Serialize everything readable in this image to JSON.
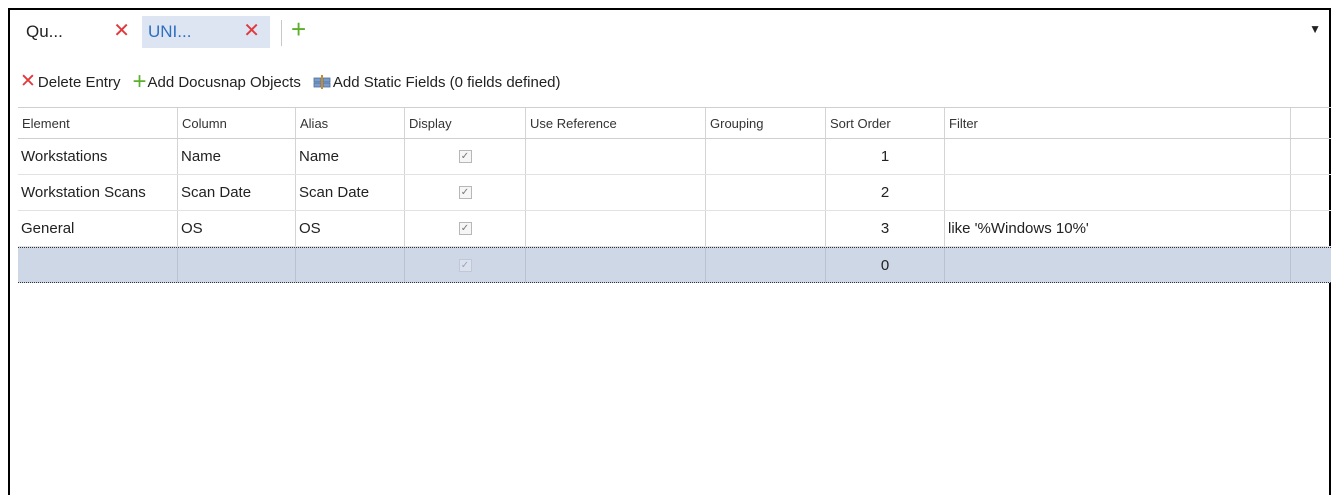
{
  "tabs": [
    {
      "label": "Qu...",
      "active": true
    },
    {
      "label": "UNI...",
      "active": false
    }
  ],
  "icons": {
    "close": "close-icon",
    "add_tab": "plus-icon",
    "dropdown": "chevron-down-icon",
    "fields": "fields-icon"
  },
  "toolbar": {
    "delete_label": "Delete Entry",
    "add_objects_label": "Add Docusnap Objects",
    "add_static_label": "Add Static Fields (0 fields defined)"
  },
  "grid": {
    "columns": [
      "Element",
      "Column",
      "Alias",
      "Display",
      "Use Reference",
      "Grouping",
      "Sort Order",
      "Filter"
    ],
    "rows": [
      {
        "element": "Workstations",
        "column": "Name",
        "alias": "Name",
        "display": true,
        "use_reference": "",
        "grouping": "",
        "sort_order": "1",
        "filter": ""
      },
      {
        "element": "Workstation Scans",
        "column": "Scan Date",
        "alias": "Scan Date",
        "display": true,
        "use_reference": "",
        "grouping": "",
        "sort_order": "2",
        "filter": ""
      },
      {
        "element": "General",
        "column": "OS",
        "alias": "OS",
        "display": true,
        "use_reference": "",
        "grouping": "",
        "sort_order": "3",
        "filter": "like '%Windows 10%'"
      },
      {
        "element": "",
        "column": "",
        "alias": "",
        "display": true,
        "use_reference": "",
        "grouping": "",
        "sort_order": "0",
        "filter": ""
      }
    ]
  },
  "colors": {
    "accent_blue": "#2e6fbf",
    "close_red": "#e0393e",
    "add_green": "#5bb02a",
    "selected_row": "#cdd7e6"
  }
}
